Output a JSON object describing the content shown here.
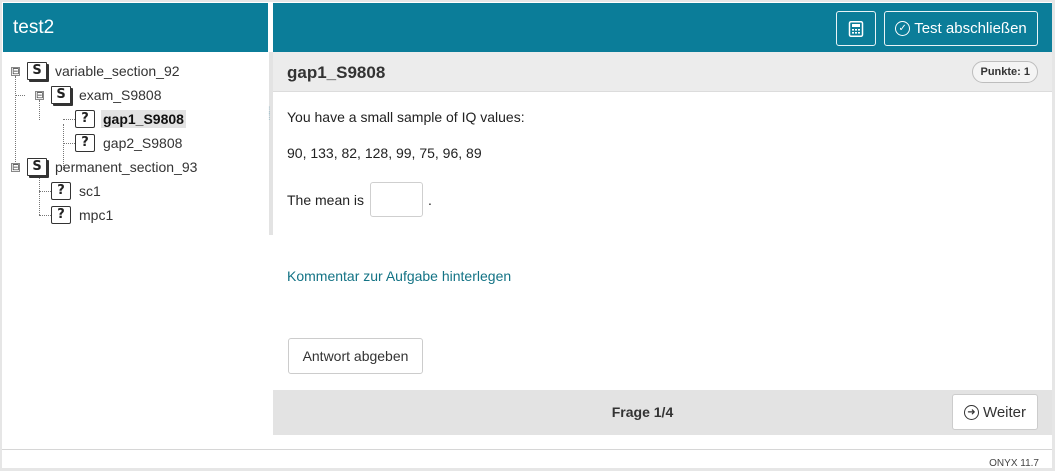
{
  "app": {
    "title": "test2",
    "version": "ONYX 11.7"
  },
  "header": {
    "calculator_icon": "calculator-icon",
    "finish_label": "Test abschließen",
    "finish_icon": "check-circle-icon"
  },
  "tree": {
    "toggle_symbol": "⊟",
    "section_icon": "S",
    "question_icon": "?",
    "nodes": [
      {
        "label": "variable_section_92",
        "type": "section"
      },
      {
        "label": "exam_S9808",
        "type": "section"
      },
      {
        "label": "gap1_S9808",
        "type": "question",
        "selected": true
      },
      {
        "label": "gap2_S9808",
        "type": "question"
      },
      {
        "label": "permanent_section_93",
        "type": "section"
      },
      {
        "label": "sc1",
        "type": "question"
      },
      {
        "label": "mpc1",
        "type": "question"
      }
    ]
  },
  "task": {
    "title": "gap1_S9808",
    "points": "Punkte: 1",
    "intro": "You have a small sample of IQ values:",
    "values": "90, 133, 82, 128, 99, 75, 96, 89",
    "prompt_before": "The mean is",
    "prompt_after": ".",
    "gap_value": "",
    "comment_link": "Kommentar zur Aufgabe hinterlegen",
    "submit_label": "Antwort abgeben"
  },
  "nav": {
    "page_indicator": "Frage 1/4",
    "next_label": "Weiter",
    "next_icon": "arrow-right-circle-icon"
  },
  "colors": {
    "brand": "#0b7d99",
    "link": "#137385"
  }
}
